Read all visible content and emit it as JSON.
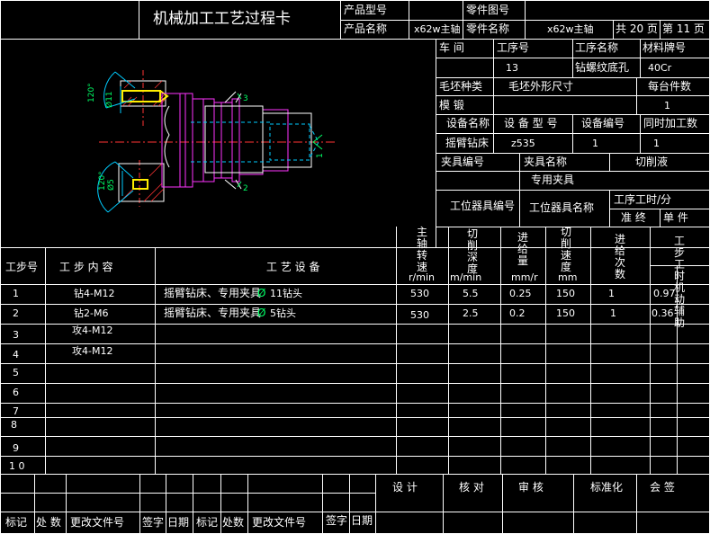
{
  "header": {
    "title": "机械加工工艺过程卡",
    "product_model_label": "产品型号",
    "product_name_label": "产品名称",
    "product_name_value": "x62w主轴",
    "part_drawing_label": "零件图号",
    "part_name_label": "零件名称",
    "part_name_value": "x62w主轴",
    "total_pages": "共 20 页",
    "page_no": "第 11 页"
  },
  "info": {
    "workshop_label": "车 间",
    "process_no_label": "工序号",
    "process_name_label": "工序名称",
    "material_label": "材料牌号",
    "process_no": "13",
    "process_name": "钻螺纹底孔",
    "material": "40Cr",
    "blank_type_label": "毛坯种类",
    "blank_size_label": "毛坯外形尺寸",
    "per_blank_label": "每台件数",
    "per_blank": "1",
    "blank_type": "模 锻",
    "equip_name_label": "设备名称",
    "equip_model_label": "设 备 型 号",
    "equip_no_label": "设备编号",
    "simul_label": "同时加工数",
    "equip_name": "摇臂钻床",
    "equip_model": "z535",
    "equip_no": "1",
    "simul": "1",
    "fixture_no_label": "夹具编号",
    "fixture_name_label": "夹具名称",
    "coolant_label": "切削液",
    "fixture_name": "专用夹具",
    "station_tool_no_label": "工位器具编号",
    "station_tool_name_label": "工位器具名称",
    "time_label": "工序工时/分",
    "prep_label": "准 终",
    "unit_label": "单 件"
  },
  "drawing": {
    "angle_top": "120°",
    "dia_top": "Ø11",
    "angle_bottom": "120°",
    "dia_bottom": "Ø5",
    "mark1": "1",
    "mark2": "2",
    "mark3": "3"
  },
  "table": {
    "col_step": "工步号",
    "col_content": "工 步 内 容",
    "col_equip": "工 艺 设 备",
    "col_speed": "主轴转速",
    "col_speed_unit": "r/min",
    "col_cut_speed": "切削深度",
    "col_cut_speed_unit": "m/min",
    "col_feed": "进给量",
    "col_feed_unit": "mm/r",
    "col_depth": "切削速度",
    "col_depth_unit": "mm",
    "col_passes": "进给次数",
    "col_time": "工步工时机动辅助",
    "rows": [
      {
        "no": "1",
        "content": "钻4-M12",
        "equip": "摇臂钻床、专用夹具",
        "icon": "Ø",
        "bit": "11钻头",
        "speed": "530",
        "cut": "5.5",
        "feed": "0.25",
        "depth": "150",
        "passes": "1",
        "time": "0.97"
      },
      {
        "no": "2",
        "content": "钻2-M6",
        "equip": "摇臂钻床、专用夹具",
        "icon": "Ø",
        "bit": "5钻头",
        "speed": "530",
        "cut": "2.5",
        "feed": "0.2",
        "depth": "150",
        "passes": "1",
        "time": "0.36"
      },
      {
        "no": "3",
        "content": "攻4-M12"
      },
      {
        "no": "4",
        "content": "攻4-M12"
      },
      {
        "no": "5"
      },
      {
        "no": "6"
      },
      {
        "no": "7"
      },
      {
        "no": "8"
      },
      {
        "no": "9"
      },
      {
        "no": "1 0"
      }
    ]
  },
  "footer": {
    "design": "设 计",
    "check": "核 对",
    "review": "审 核",
    "standard": "标准化",
    "countersign": "会 签",
    "mark": "标记",
    "count": "处 数",
    "change_doc": "更改文件号",
    "sign": "签字",
    "date": "日期",
    "mark2": "标记",
    "count2": "处数",
    "change_doc2": "更改文件号",
    "sign2": "签字",
    "date2": "日期"
  }
}
